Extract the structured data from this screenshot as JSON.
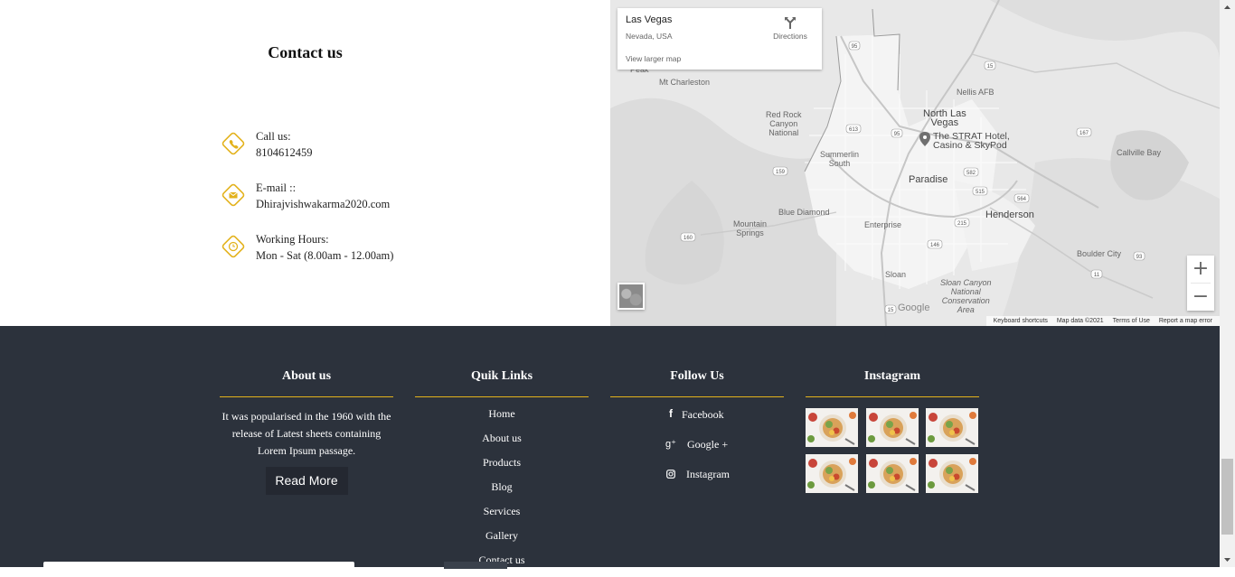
{
  "contact": {
    "title": "Contact us",
    "items": [
      {
        "label": "Call us:",
        "value": "8104612459",
        "icon": "phone-icon"
      },
      {
        "label": "E-mail ::",
        "value": "Dhirajvishwakarma2020.com",
        "icon": "mail-icon"
      },
      {
        "label": "Working Hours:",
        "value": "Mon - Sat (8.00am - 12.00am)",
        "icon": "clock-icon"
      }
    ]
  },
  "map": {
    "place_title": "Las Vegas",
    "place_subtitle": "Nevada, USA",
    "directions_label": "Directions",
    "view_larger": "View larger map",
    "labels": {
      "mt_charleston": "Mt Charleston",
      "peak": "Peak",
      "red_rock": "Red Rock\nCanyon\nNational",
      "north_las_vegas": "North Las\nVegas",
      "nellis": "Nellis AFB",
      "strat": "The STRAT Hotel,\nCasino & SkyPod",
      "summerlin": "Summerlin\nSouth",
      "paradise": "Paradise",
      "callville": "Callville Bay",
      "blue_diamond": "Blue Diamond",
      "mountain_springs": "Mountain\nSprings",
      "enterprise": "Enterprise",
      "henderson": "Henderson",
      "boulder_city": "Boulder City",
      "sloan": "Sloan",
      "sloan_canyon": "Sloan Canyon\nNational\nConservation\nArea"
    },
    "route_shields": {
      "r95_north": "95",
      "r15_ne": "15",
      "r167": "167",
      "r613": "613",
      "r95_mid": "95",
      "r159": "159",
      "r582": "582",
      "r515": "515",
      "r564": "564",
      "r215": "215",
      "r160": "160",
      "r146": "146",
      "r93": "93",
      "r11": "11",
      "r15_s": "15"
    },
    "google": "Google",
    "attribution": [
      "Keyboard shortcuts",
      "Map data ©2021",
      "Terms of Use",
      "Report a map error"
    ],
    "zoom_in": "+",
    "zoom_out": "−"
  },
  "footer": {
    "about": {
      "title": "About us",
      "text": "It was popularised in the 1960 with the release of Latest sheets containing Lorem Ipsum passage.",
      "button": "Read More"
    },
    "quick_links": {
      "title": "Quik Links",
      "items": [
        "Home",
        "About us",
        "Products",
        "Blog",
        "Services",
        "Gallery",
        "Contact us"
      ]
    },
    "follow": {
      "title": "Follow Us",
      "items": [
        {
          "icon": "facebook-icon",
          "glyph": "f",
          "label": "Facebook"
        },
        {
          "icon": "google-plus-icon",
          "glyph": "g⁺",
          "label": "Google +"
        },
        {
          "icon": "instagram-icon",
          "glyph": "",
          "label": "Instagram"
        }
      ]
    },
    "instagram": {
      "title": "Instagram",
      "thumbnails": 6
    }
  },
  "colors": {
    "accent": "#e3b21c",
    "footer_bg": "#2c323c",
    "button_bg": "#242831",
    "map_bg": "#e9e9e9"
  }
}
